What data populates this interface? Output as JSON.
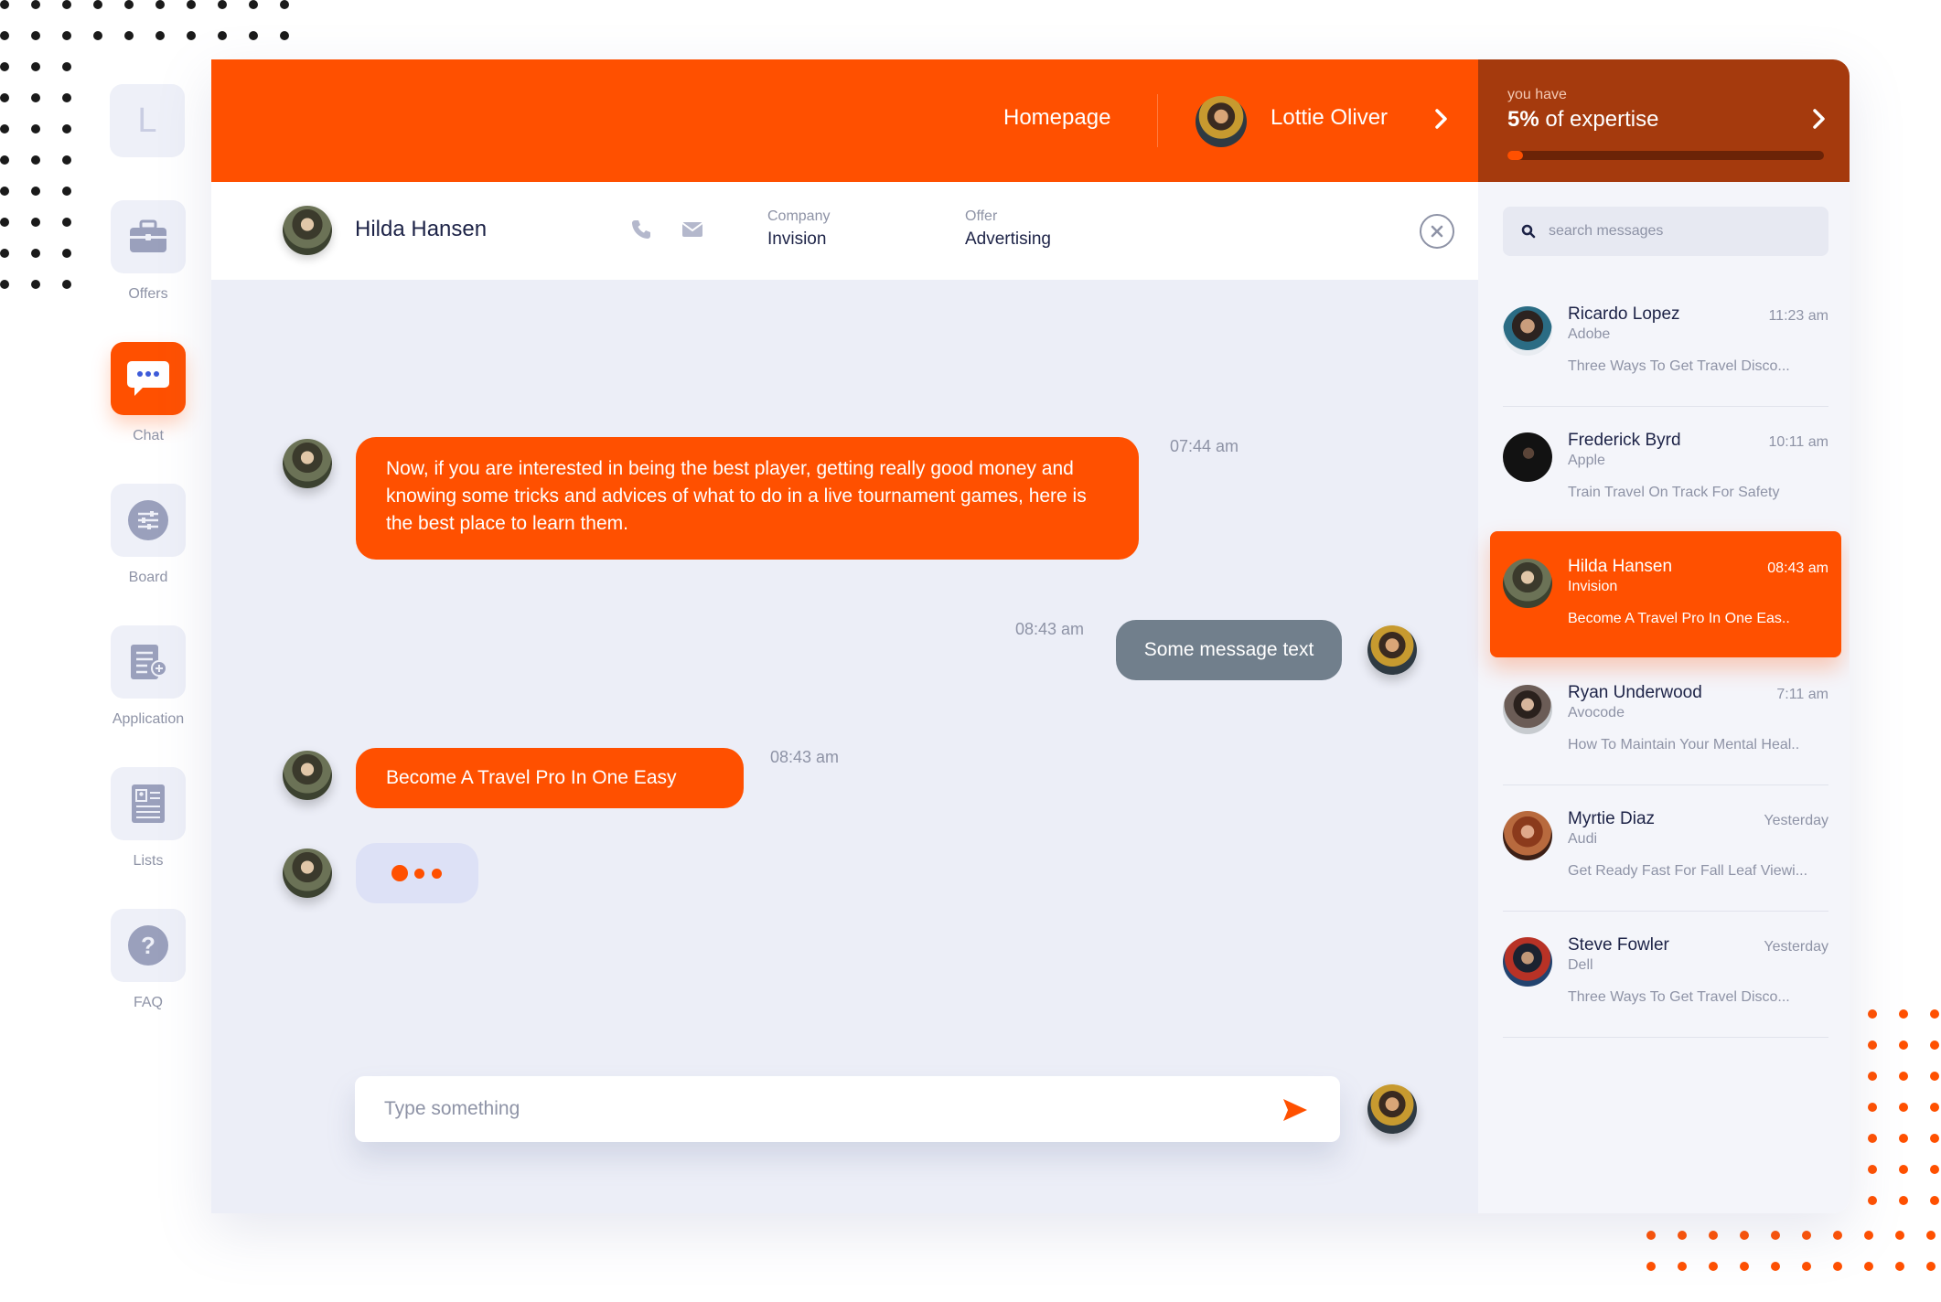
{
  "colors": {
    "accent": "#ff5000",
    "expertise_bg": "#a53a0d",
    "text_dark": "#1d2347",
    "text_muted": "#8e93a6",
    "chat_bg": "#eceef7",
    "bubble_gray": "#717f8c"
  },
  "nav": {
    "logo_letter": "L",
    "items": [
      {
        "label": "Offers",
        "icon": "briefcase-icon",
        "active": false
      },
      {
        "label": "Chat",
        "icon": "chat-bubble-icon",
        "active": true
      },
      {
        "label": "Board",
        "icon": "sliders-icon",
        "active": false
      },
      {
        "label": "Application",
        "icon": "document-add-icon",
        "active": false
      },
      {
        "label": "Lists",
        "icon": "contact-list-icon",
        "active": false
      },
      {
        "label": "FAQ",
        "icon": "question-icon",
        "active": false
      }
    ]
  },
  "topbar": {
    "homepage_label": "Homepage",
    "user_name": "Lottie Oliver"
  },
  "expertise": {
    "caption": "you have",
    "percent_label": "5%",
    "suffix": "of expertise",
    "progress": 0.05
  },
  "contact": {
    "name": "Hilda Hansen",
    "company_label": "Company",
    "company_value": "Invision",
    "offer_label": "Offer",
    "offer_value": "Advertising"
  },
  "messages": [
    {
      "side": "left",
      "text": "Now, if you are interested in being the best player, getting really good money and knowing some tricks and advices of what to do in a live tournament games, here is the best place to learn them.",
      "time": "07:44 am"
    },
    {
      "side": "right",
      "text": "Some message text",
      "time": "08:43 am"
    },
    {
      "side": "left",
      "text": "Become A Travel Pro In One Easy",
      "time": "08:43 am"
    }
  ],
  "compose": {
    "placeholder": "Type something"
  },
  "search": {
    "placeholder": "search messages"
  },
  "conversations": [
    {
      "name": "Ricardo Lopez",
      "company": "Adobe",
      "time": "11:23 am",
      "preview": "Three Ways To Get Travel Disco...",
      "active": false
    },
    {
      "name": "Frederick Byrd",
      "company": "Apple",
      "time": "10:11 am",
      "preview": "Train Travel On Track For Safety",
      "active": false
    },
    {
      "name": "Hilda Hansen",
      "company": "Invision",
      "time": "08:43 am",
      "preview": "Become A Travel Pro In One Eas..",
      "active": true
    },
    {
      "name": "Ryan Underwood",
      "company": "Avocode",
      "time": "7:11 am",
      "preview": "How To Maintain Your Mental Heal..",
      "active": false
    },
    {
      "name": "Myrtie Diaz",
      "company": "Audi",
      "time": "Yesterday",
      "preview": "Get Ready Fast For Fall Leaf Viewi...",
      "active": false
    },
    {
      "name": "Steve Fowler",
      "company": "Dell",
      "time": "Yesterday",
      "preview": "Three Ways To Get Travel Disco...",
      "active": false
    }
  ]
}
